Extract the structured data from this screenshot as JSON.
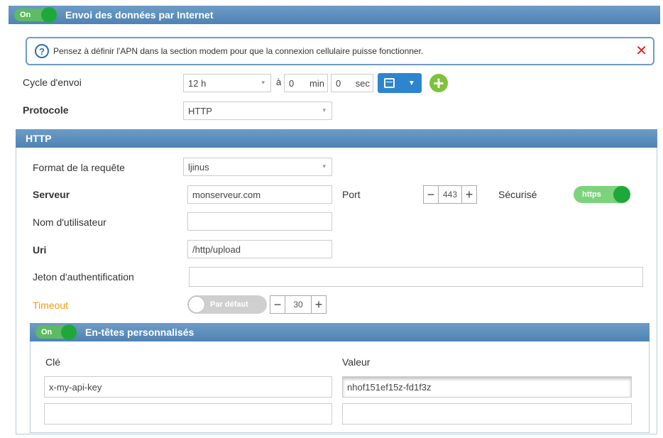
{
  "main_section": {
    "toggle_label": "On",
    "title": "Envoi des données par Internet"
  },
  "info": {
    "icon": "help-icon",
    "text": "Pensez à définir l'APN dans la section modem pour que la connexion cellulaire puisse fonctionner.",
    "close_icon": "close-icon"
  },
  "cycle": {
    "label": "Cycle d'envoi",
    "value": "12 h",
    "at_label": "à",
    "min_value": "0",
    "min_unit": "min",
    "sec_value": "0",
    "sec_unit": "sec"
  },
  "protocol": {
    "label": "Protocole",
    "value": "HTTP"
  },
  "http_section": {
    "title": "HTTP",
    "request_format": {
      "label": "Format de la requête",
      "value": "ljinus"
    },
    "server": {
      "label": "Serveur",
      "value": "monserveur.com"
    },
    "port": {
      "label": "Port",
      "value": "443",
      "minus": "−",
      "plus": "+"
    },
    "secure": {
      "label": "Sécurisé",
      "toggle_label": "https"
    },
    "username": {
      "label": "Nom d'utilisateur",
      "value": ""
    },
    "uri": {
      "label": "Uri",
      "value": "/http/upload"
    },
    "token": {
      "label": "Jeton d'authentification",
      "value": ""
    },
    "timeout": {
      "label": "Timeout",
      "default_label": "Par défaut",
      "value": "30",
      "minus": "−",
      "plus": "+"
    }
  },
  "headers_section": {
    "toggle_label": "On",
    "title": "En-têtes personnalisés",
    "key_header": "Clé",
    "value_header": "Valeur",
    "rows": [
      {
        "key": "x-my-api-key",
        "value": "nhof151ef15z-fd1f3z"
      },
      {
        "key": "",
        "value": ""
      }
    ]
  },
  "colors": {
    "header_bar": "#5a8dbb",
    "toggle_on": "#1fa83a",
    "accent_blue": "#2d85cf",
    "add_green": "#7ec23a",
    "close_red": "#d22222",
    "timeout_orange": "#f39c12"
  }
}
